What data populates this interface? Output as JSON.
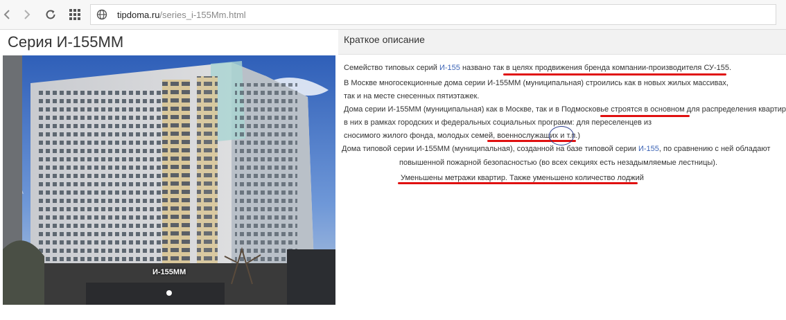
{
  "browser": {
    "url_host": "tipdoma.ru",
    "url_path": "/series_i-155Mm.html"
  },
  "page": {
    "title": "Серия И-155ММ",
    "photo_caption": "И-155ММ"
  },
  "description": {
    "heading": "Краткое описание",
    "lines": [
      {
        "before": "Семейство типовых серий ",
        "link": "И-155",
        "after": " названо так в целях продвижения бренда компании-производителя СУ-155."
      },
      {
        "text": "В Москве многосекционные дома серии И-155ММ (муниципальная) строились как в новых жилых массивах,"
      },
      {
        "text": "так и на месте снесенных пятиэтажек."
      },
      {
        "text": "Дома серии И-155ММ (муниципальная) как в Москве, так и в Подмосковье строятся в основном для распределения квартир"
      },
      {
        "text": "в них в рамках городских и федеральных социальных программ: для переселенцев из"
      },
      {
        "text": "сносимого жилого фонда, молодых семей, военнослужащих и т.п.)"
      },
      {
        "before": "Дома типовой серии И-155ММ (муниципальная), созданной на базе типовой серии ",
        "link": "И-155",
        "after": ", по сравнению с ней обладают"
      },
      {
        "text": "повышенной пожарной безопасностью (во всех секциях есть незадымляемые лестницы)."
      },
      {
        "text": "Уменьшены метражи квартир. Также уменьшено количество лоджий"
      }
    ]
  },
  "colors": {
    "link": "#3b63b5",
    "underline_marker": "#e01010",
    "circle_marker": "#2a3d8f"
  }
}
